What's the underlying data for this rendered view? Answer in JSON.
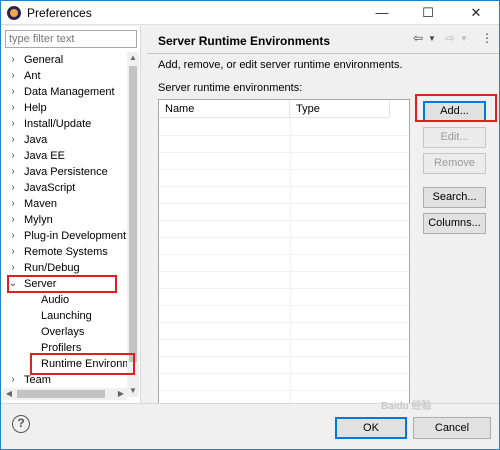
{
  "window": {
    "title": "Preferences",
    "minimize": "—",
    "maximize": "☐",
    "close": "✕"
  },
  "filter": {
    "placeholder": "type filter text",
    "value": ""
  },
  "tree": {
    "items": [
      {
        "label": "General",
        "expander": "›"
      },
      {
        "label": "Ant",
        "expander": "›"
      },
      {
        "label": "Data Management",
        "expander": "›"
      },
      {
        "label": "Help",
        "expander": "›"
      },
      {
        "label": "Install/Update",
        "expander": "›"
      },
      {
        "label": "Java",
        "expander": "›"
      },
      {
        "label": "Java EE",
        "expander": "›"
      },
      {
        "label": "Java Persistence",
        "expander": "›"
      },
      {
        "label": "JavaScript",
        "expander": "›"
      },
      {
        "label": "Maven",
        "expander": "›"
      },
      {
        "label": "Mylyn",
        "expander": "›"
      },
      {
        "label": "Plug-in Development",
        "expander": "›"
      },
      {
        "label": "Remote Systems",
        "expander": "›"
      },
      {
        "label": "Run/Debug",
        "expander": "›"
      },
      {
        "label": "Server",
        "expander": "⌄"
      }
    ],
    "server_children": [
      "Audio",
      "Launching",
      "Overlays",
      "Profilers",
      "Runtime Environm"
    ],
    "after": {
      "label": "Team",
      "expander": "›"
    }
  },
  "page": {
    "title": "Server Runtime Environments",
    "back_icon": "⇦",
    "forward_icon": "⇨",
    "menu_icon": "⋮",
    "description": "Add, remove, or edit server runtime environments.",
    "list_label": "Server runtime environments:",
    "columns": [
      "Name",
      "Type"
    ]
  },
  "buttons": {
    "add": "Add...",
    "edit": "Edit...",
    "remove": "Remove",
    "search": "Search...",
    "columns": "Columns..."
  },
  "dialog": {
    "ok": "OK",
    "cancel": "Cancel",
    "help": "?"
  },
  "watermark": "Baidu 经验",
  "colors": {
    "highlight": "#e02020",
    "focus": "#0078d7"
  }
}
